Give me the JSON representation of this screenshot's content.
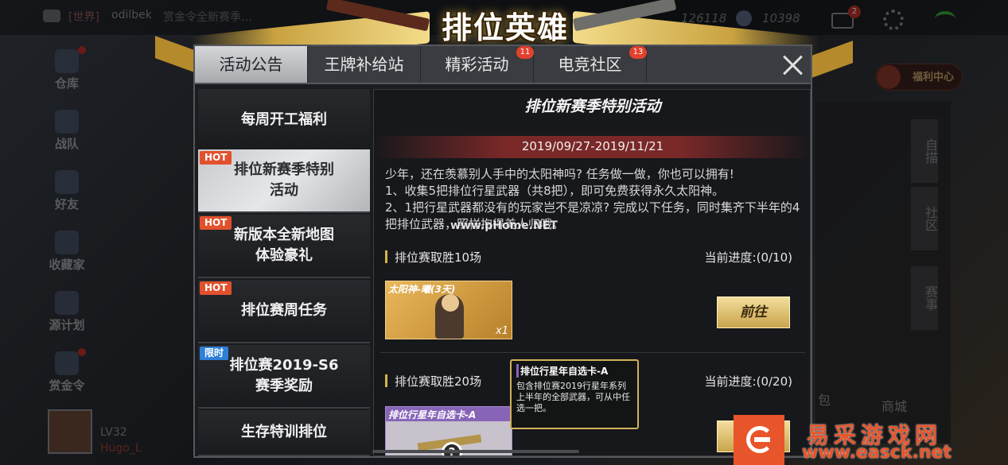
{
  "header": {
    "world_tag": "[世界]",
    "world_user": "odilbek",
    "world_msg": "赏金令全新赛季…",
    "currency_1": "126118",
    "currency_2": "10398",
    "mail_count": "2"
  },
  "side_nav": [
    "仓库",
    "战队",
    "好友",
    "收藏家",
    "源计划",
    "赏金令"
  ],
  "player": {
    "level": "LV32",
    "name": "Hugo_L"
  },
  "right_panel": {
    "welfare": "福利中心",
    "tabs": [
      "自描",
      "社区",
      "赛事"
    ],
    "shop": "商城",
    "bag": "包"
  },
  "banner": {
    "title": "排位英雄"
  },
  "tabs": [
    {
      "label": "活动公告",
      "badge": ""
    },
    {
      "label": "王牌补给站",
      "badge": ""
    },
    {
      "label": "精彩活动",
      "badge": "11"
    },
    {
      "label": "电竞社区",
      "badge": "13"
    }
  ],
  "list": [
    {
      "label": "每周开工福利",
      "tag": ""
    },
    {
      "label": "排位新赛季特别活动",
      "tag": "HOT"
    },
    {
      "label": "新版本全新地图体验豪礼",
      "tag": "HOT"
    },
    {
      "label": "排位赛周任务",
      "tag": "HOT"
    },
    {
      "label": "排位赛2019-S6赛季奖励",
      "tag": "限时"
    },
    {
      "label": "生存特训排位",
      "tag": ""
    }
  ],
  "content": {
    "title": "排位新赛季特别活动",
    "date": "2019/09/27-2019/11/21",
    "desc": [
      "少年，还在羡慕别人手中的太阳神吗? 任务做一做，你也可以拥有!",
      "1、收集5把排位行星武器（共8把），即可免费获得永久太阳神。",
      "2、1把行星武器都没有的玩家岂不是凉凉? 完成以下任务，同时集齐下半年的4把排位武器，照样抱得美人归哦。"
    ],
    "tasks": [
      {
        "name": "排位赛取胜10场",
        "progress": "当前进度:(0/10)",
        "reward": "太阳神-曦(3天)",
        "qty": "x1",
        "button": "前往"
      },
      {
        "name": "排位赛取胜20场",
        "progress": "当前进度:(0/20)",
        "reward": "排位行星年自选卡-A",
        "qty": "",
        "button": ""
      }
    ],
    "tooltip": {
      "title": "排位行星年自选卡-A",
      "text": "包含排位赛2019行星年系列上半年的全部武器，可从中任选一把。"
    }
  },
  "watermark": {
    "center": "www.pHome.NET",
    "name": "易采游戏网",
    "url": "www.easck.net"
  }
}
